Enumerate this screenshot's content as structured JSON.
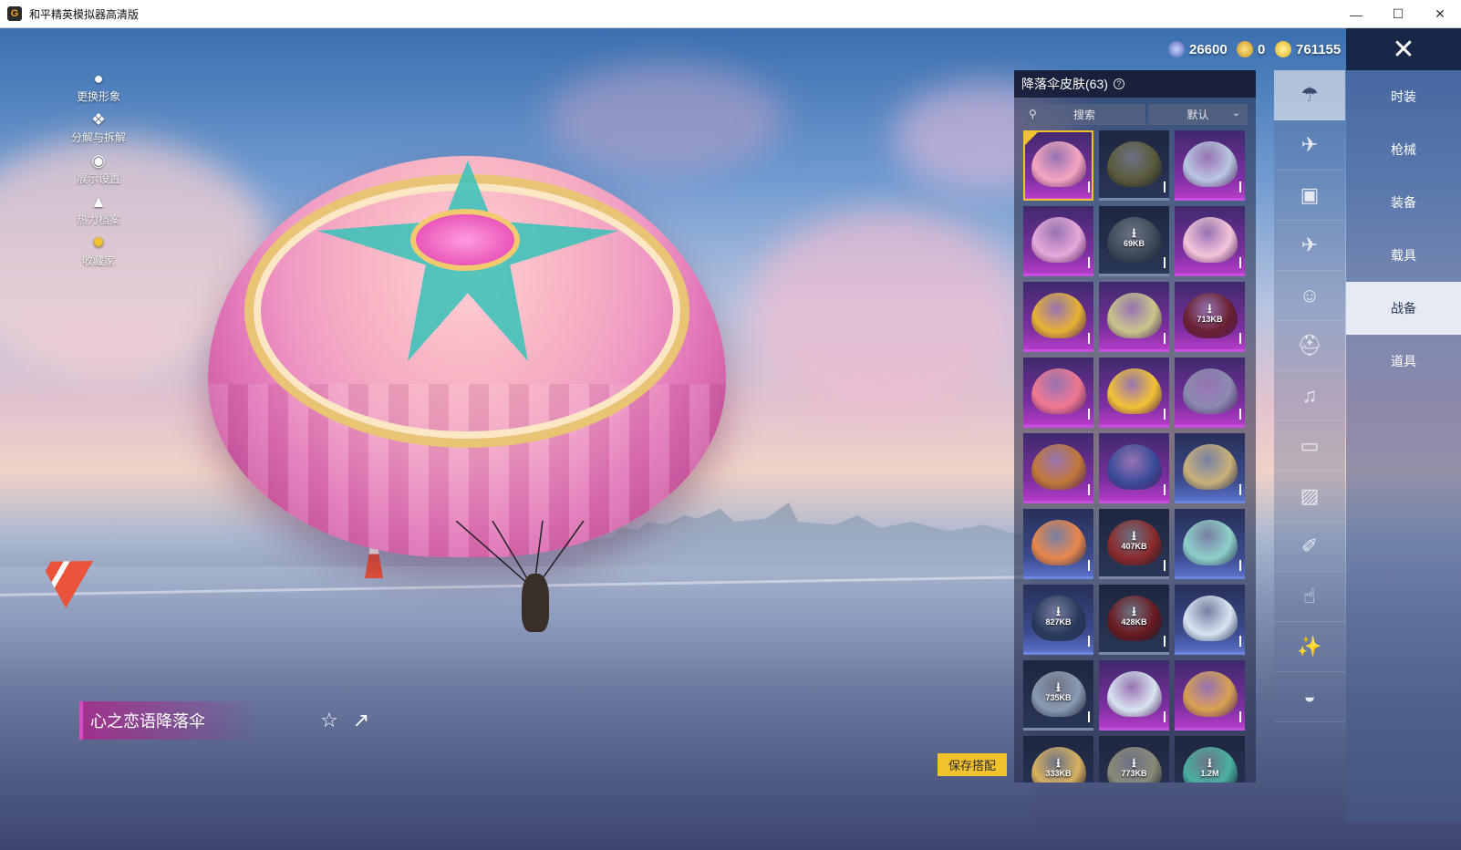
{
  "window": {
    "title": "和平精英模拟器高清版",
    "controls": [
      "minimize",
      "maximize",
      "close"
    ]
  },
  "currency": [
    {
      "icon": "gem-coin-icon",
      "value": "26600"
    },
    {
      "icon": "gold-a-coin-icon",
      "value": "0"
    },
    {
      "icon": "yellow-coin-icon",
      "value": "761155"
    }
  ],
  "left_menu": [
    {
      "icon": "avatar-icon",
      "label": "更换形象"
    },
    {
      "icon": "puzzle-icon",
      "label": "分解与拆解"
    },
    {
      "icon": "eye-icon",
      "label": "展示设置"
    },
    {
      "icon": "flame-icon",
      "label": "热力档案"
    },
    {
      "icon": "collector-badge-icon",
      "label": "收藏家"
    }
  ],
  "skin": {
    "name": "心之恋语降落伞",
    "favorite_icon": "star-plus-icon",
    "share_icon": "share-icon"
  },
  "save_button": "保存搭配",
  "panel": {
    "title": "降落伞皮肤(63)",
    "search_placeholder": "搜索",
    "sort_label": "默认",
    "tiles": [
      {
        "style": "purple",
        "selected": true,
        "color": "#f5a6c0",
        "download": ""
      },
      {
        "style": "dark",
        "selected": false,
        "color": "#5a5a3a",
        "download": ""
      },
      {
        "style": "purple",
        "selected": false,
        "color": "#b8c6e0",
        "download": ""
      },
      {
        "style": "purple",
        "selected": false,
        "color": "#e6a8d8",
        "download": ""
      },
      {
        "style": "dark",
        "selected": false,
        "color": "#3c4a58",
        "download": "69KB"
      },
      {
        "style": "purple",
        "selected": false,
        "color": "#f4c4d8",
        "download": ""
      },
      {
        "style": "purple",
        "selected": false,
        "color": "#e6b232",
        "download": ""
      },
      {
        "style": "purple",
        "selected": false,
        "color": "#c8c68a",
        "download": ""
      },
      {
        "style": "purple",
        "selected": false,
        "color": "#6a2030",
        "download": "713KB"
      },
      {
        "style": "purple",
        "selected": false,
        "color": "#f07890",
        "download": ""
      },
      {
        "style": "purple",
        "selected": false,
        "color": "#f2c232",
        "download": ""
      },
      {
        "style": "purple",
        "selected": false,
        "color": "#8a8ab0",
        "download": ""
      },
      {
        "style": "purple",
        "selected": false,
        "color": "#c07838",
        "download": ""
      },
      {
        "style": "purple",
        "selected": false,
        "color": "#3a4c9a",
        "download": ""
      },
      {
        "style": "blue",
        "selected": false,
        "color": "#c8b078",
        "download": ""
      },
      {
        "style": "blue",
        "selected": false,
        "color": "#e8864a",
        "download": ""
      },
      {
        "style": "dark",
        "selected": false,
        "color": "#8a2a2a",
        "download": "407KB"
      },
      {
        "style": "blue",
        "selected": false,
        "color": "#8fd0c8",
        "download": ""
      },
      {
        "style": "blue",
        "selected": false,
        "color": "#2a3a5a",
        "download": "827KB"
      },
      {
        "style": "dark",
        "selected": false,
        "color": "#6a1a20",
        "download": "428KB"
      },
      {
        "style": "blue",
        "selected": false,
        "color": "#d8e4f0",
        "download": ""
      },
      {
        "style": "dark",
        "selected": false,
        "color": "#8a9ab0",
        "download": "735KB"
      },
      {
        "style": "purple",
        "selected": false,
        "color": "#d8e4f0",
        "download": ""
      },
      {
        "style": "purple",
        "selected": false,
        "color": "#d8a050",
        "download": ""
      },
      {
        "style": "dark",
        "selected": false,
        "color": "#d8b060",
        "download": "333KB"
      },
      {
        "style": "dark",
        "selected": false,
        "color": "#8a8a78",
        "download": "773KB"
      },
      {
        "style": "dark",
        "selected": false,
        "color": "#4ab0a0",
        "download": "1.2M"
      }
    ]
  },
  "icon_column": [
    {
      "icon": "parachute-icon",
      "active": true
    },
    {
      "icon": "airplane-trail-icon",
      "active": false
    },
    {
      "icon": "backpack-icon",
      "active": false
    },
    {
      "icon": "plane-icon",
      "active": false
    },
    {
      "icon": "emote-face-icon",
      "active": false
    },
    {
      "icon": "helmet-icon",
      "active": false
    },
    {
      "icon": "speaker-icon",
      "active": false
    },
    {
      "icon": "chat-bubble-icon",
      "active": false
    },
    {
      "icon": "picture-icon",
      "active": false
    },
    {
      "icon": "spray-can-icon",
      "active": false
    },
    {
      "icon": "finger-tap-icon",
      "active": false
    },
    {
      "icon": "magic-wand-icon",
      "active": false
    },
    {
      "icon": "dish-icon",
      "active": false
    }
  ],
  "categories": [
    {
      "label": "时装",
      "active": false
    },
    {
      "label": "枪械",
      "active": false
    },
    {
      "label": "装备",
      "active": false
    },
    {
      "label": "载具",
      "active": false
    },
    {
      "label": "战备",
      "active": true
    },
    {
      "label": "道具",
      "active": false
    }
  ],
  "close_icon": "close-x-icon"
}
